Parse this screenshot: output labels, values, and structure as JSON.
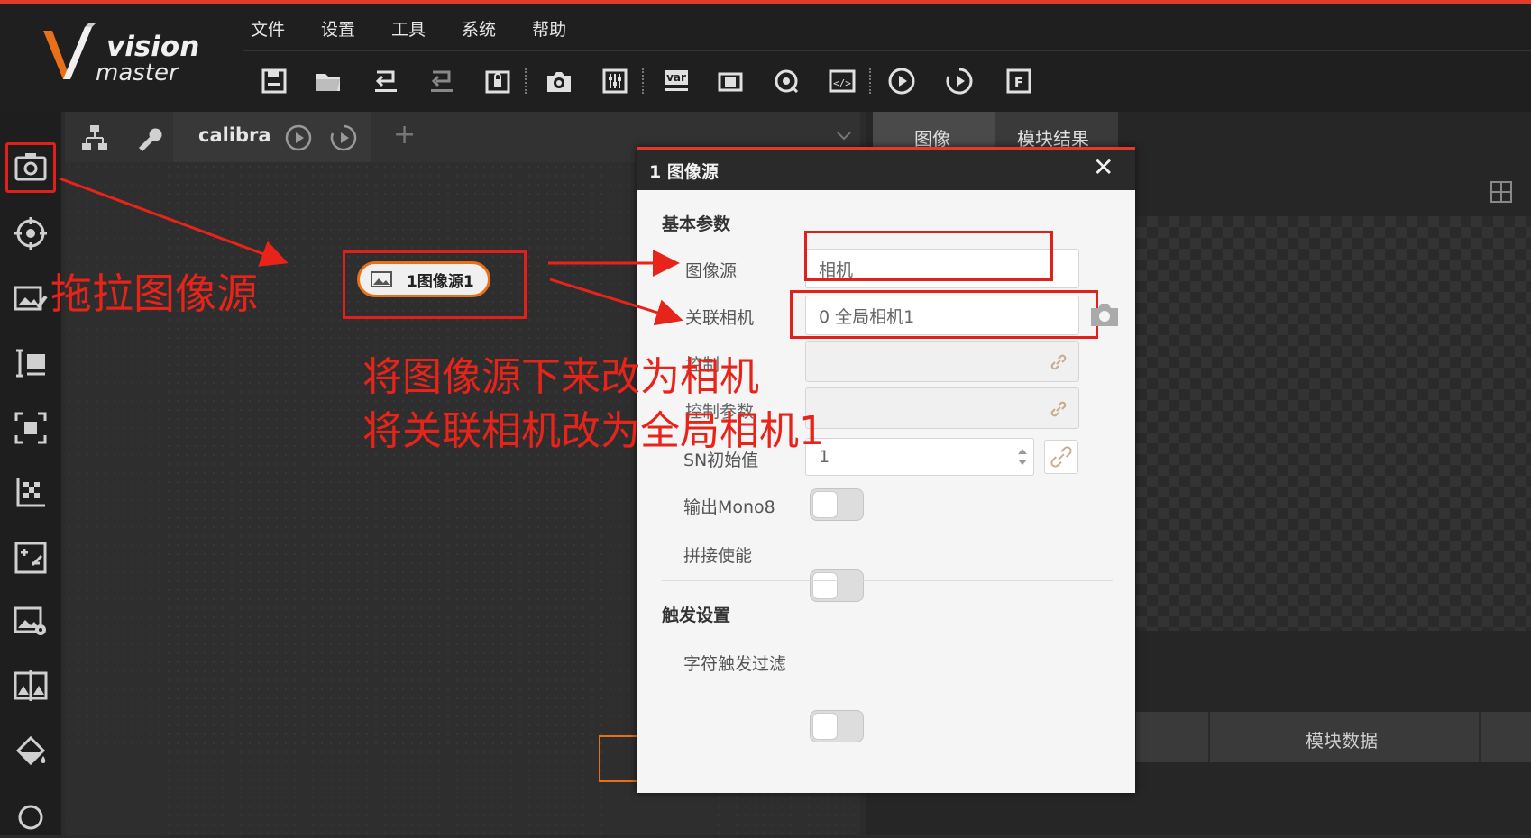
{
  "app": {
    "logo_vision": "vision",
    "logo_master": "master"
  },
  "menu": [
    "文件",
    "设置",
    "工具",
    "系统",
    "帮助"
  ],
  "canvas": {
    "solution_tab": "calibra",
    "add_symbol": "+"
  },
  "node": {
    "label": "1图像源1"
  },
  "right_panel": {
    "tabs": [
      "图像",
      "模块结果"
    ],
    "bottom_label": "模块数据"
  },
  "dialog": {
    "title": "1 图像源",
    "close_symbol": "✕",
    "section_basic": "基本参数",
    "image_source": {
      "label": "图像源",
      "value": "相机"
    },
    "linked_camera": {
      "label": "关联相机",
      "value": "0 全局相机1"
    },
    "hidden_field_1": {
      "label": "控制",
      "value": ""
    },
    "hidden_field_2": {
      "label": "控制参数",
      "value": ""
    },
    "sn_initial": {
      "label": "SN初始值",
      "value": "1"
    },
    "output_mono8": {
      "label": "输出Mono8"
    },
    "stitch_enable": {
      "label": "拼接使能"
    },
    "section_trigger": "触发设置",
    "char_trigger_filter": {
      "label": "字符触发过滤"
    }
  },
  "annotations": {
    "drag": "拖拉图像源",
    "line1": "将图像源下来改为相机",
    "line2": "将关联相机改为全局相机1"
  },
  "colors": {
    "accent_red": "#e0201a",
    "node_orange": "#e8701a"
  }
}
